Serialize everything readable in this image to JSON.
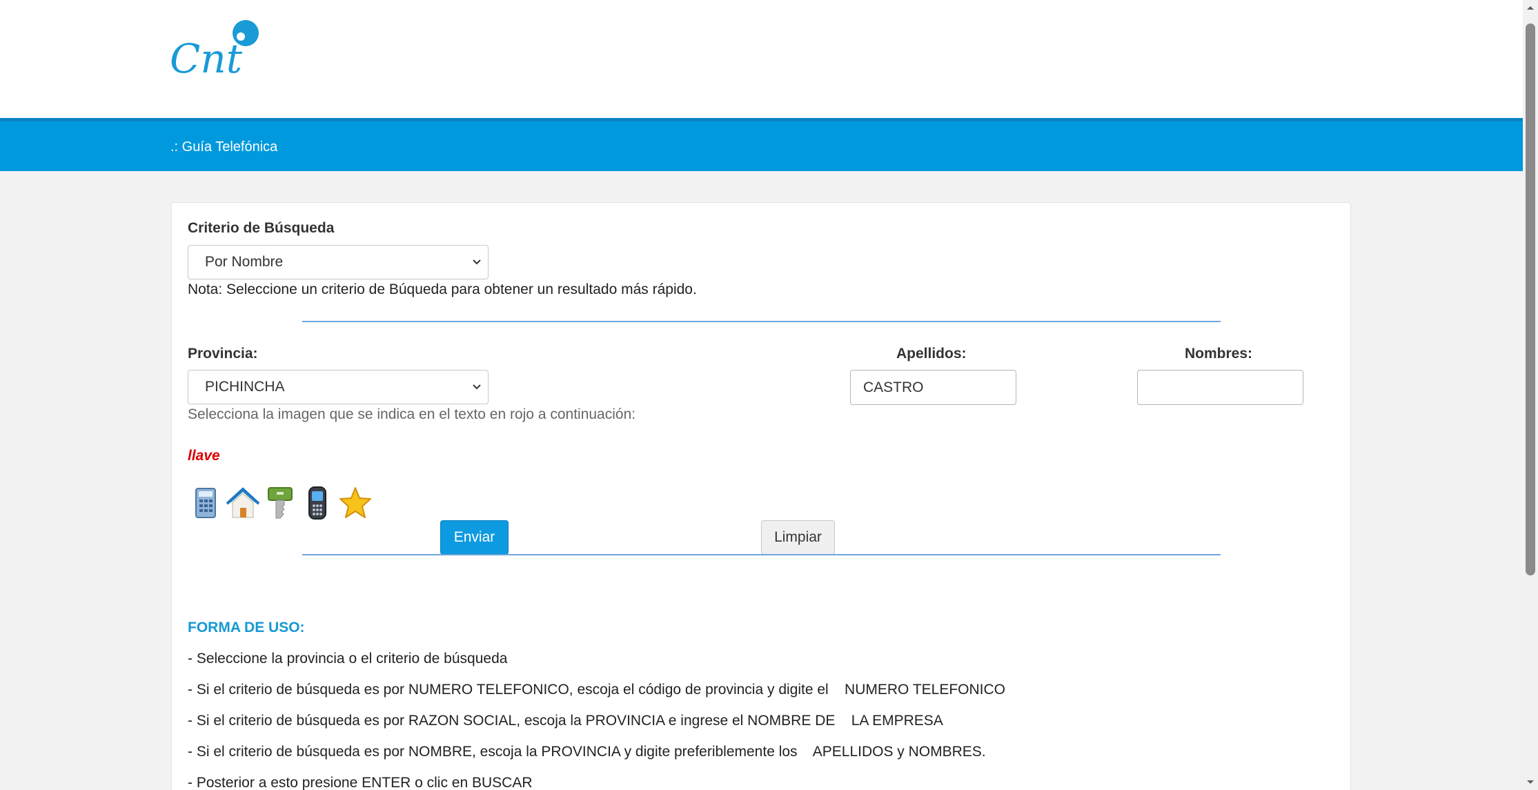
{
  "header": {
    "logo_text": "Cnt",
    "nav_title": ".: Guía Telefónica"
  },
  "search": {
    "criteria_label": "Criterio de Búsqueda",
    "criteria_value": "Por Nombre",
    "note": "Nota: Seleccione un criterio de Búqueda para obtener un resultado más rápido.",
    "province_label": "Provincia:",
    "province_value": "PICHINCHA",
    "surnames_label": "Apellidos:",
    "surnames_value": "CASTRO",
    "names_label": "Nombres:",
    "names_value": ""
  },
  "captcha": {
    "instruction": "Selecciona la imagen que se indica en el texto en rojo a continuación:",
    "word": "llave",
    "images": [
      "calculator-icon",
      "house-icon",
      "key-icon",
      "cellphone-icon",
      "star-icon"
    ]
  },
  "buttons": {
    "submit": "Enviar",
    "clear": "Limpiar"
  },
  "usage": {
    "title": "FORMA DE USO:",
    "lines": [
      "- Seleccione la provincia o el criterio de búsqueda",
      "- Si el criterio de búsqueda es por NUMERO TELEFONICO, escoja el código de provincia y digite el    NUMERO TELEFONICO",
      "- Si el criterio de búsqueda es por RAZON SOCIAL, escoja la PROVINCIA e ingrese el NOMBRE DE    LA EMPRESA",
      "- Si el criterio de búsqueda es por NOMBRE, escoja la PROVINCIA y digite preferiblemente los    APELLIDOS y NOMBRES.",
      "- Posterior a esto presione ENTER o clic en BUSCAR"
    ]
  },
  "colors": {
    "brand_blue": "#0099dd",
    "captcha_red": "#dd0000",
    "usage_title": "#1698d4"
  }
}
